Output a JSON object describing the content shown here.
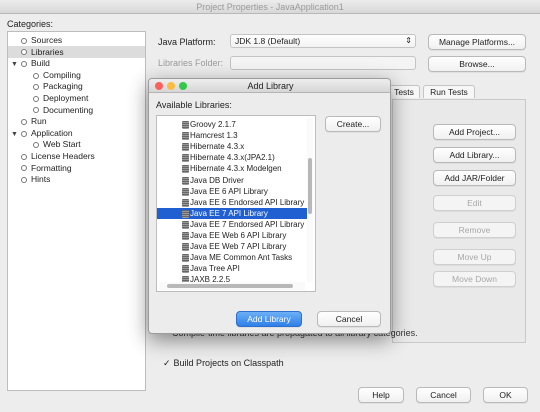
{
  "window": {
    "title": "Project Properties - JavaApplication1"
  },
  "categories": {
    "label": "Categories:",
    "items": [
      {
        "label": "Sources",
        "depth": 0,
        "expand": ""
      },
      {
        "label": "Libraries",
        "depth": 0,
        "expand": "",
        "selected": true
      },
      {
        "label": "Build",
        "depth": 0,
        "expand": "▼"
      },
      {
        "label": "Compiling",
        "depth": 1,
        "expand": ""
      },
      {
        "label": "Packaging",
        "depth": 1,
        "expand": ""
      },
      {
        "label": "Deployment",
        "depth": 1,
        "expand": ""
      },
      {
        "label": "Documenting",
        "depth": 1,
        "expand": ""
      },
      {
        "label": "Run",
        "depth": 0,
        "expand": ""
      },
      {
        "label": "Application",
        "depth": 0,
        "expand": "▼"
      },
      {
        "label": "Web Start",
        "depth": 1,
        "expand": ""
      },
      {
        "label": "License Headers",
        "depth": 0,
        "expand": ""
      },
      {
        "label": "Formatting",
        "depth": 0,
        "expand": ""
      },
      {
        "label": "Hints",
        "depth": 0,
        "expand": ""
      }
    ]
  },
  "libraries_panel": {
    "java_platform_label": "Java Platform:",
    "java_platform_value": "JDK 1.8 (Default)",
    "manage_platforms_label": "Manage Platforms...",
    "libraries_folder_label": "Libraries Folder:",
    "browse_label": "Browse...",
    "tabs": [
      "Tests",
      "Run Tests"
    ],
    "buttons": {
      "add_project": "Add Project...",
      "add_library": "Add Library...",
      "add_jar": "Add JAR/Folder",
      "edit": "Edit",
      "remove": "Remove",
      "move_up": "Move Up",
      "move_down": "Move Down"
    },
    "footnote": "Compile-time libraries are propagated to all library categories.",
    "build_classpath_label": "Build Projects on Classpath",
    "build_classpath_checked": true
  },
  "footer": {
    "help": "Help",
    "cancel": "Cancel",
    "ok": "OK"
  },
  "dialog": {
    "title": "Add Library",
    "available_label": "Available Libraries:",
    "create_label": "Create...",
    "add_library_label": "Add Library",
    "cancel_label": "Cancel",
    "libraries": [
      "Groovy 2.1.7",
      "Hamcrest 1.3",
      "Hibernate 4.3.x",
      "Hibernate 4.3.x(JPA2.1)",
      "Hibernate 4.3.x Modelgen",
      "Java DB Driver",
      "Java EE 6 API Library",
      "Java EE 6 Endorsed API Library",
      "Java EE 7 API Library",
      "Java EE 7 Endorsed API Library",
      "Java EE Web 6 API Library",
      "Java EE Web 7 API Library",
      "Java ME Common Ant Tasks",
      "Java Tree API",
      "JAXB 2.2.5"
    ],
    "selected_library": "Java EE 7 API Library"
  },
  "colors": {
    "selection": "#1f5fd1",
    "primary_button": "#2f7fe8",
    "close_light": "#fc605c",
    "minimize_light": "#fdbc40",
    "zoom_light": "#34c84a"
  }
}
